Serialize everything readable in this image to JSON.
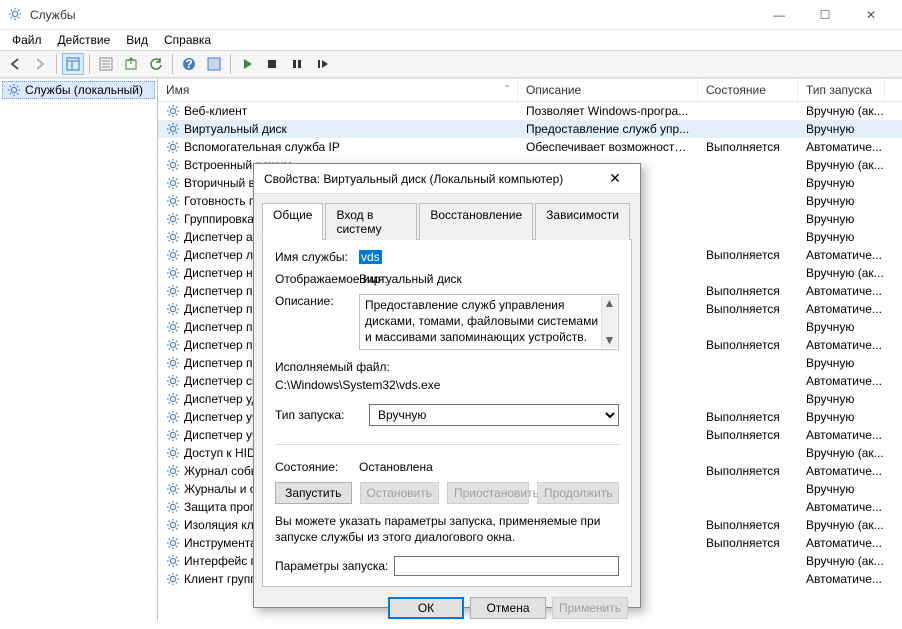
{
  "window": {
    "title": "Службы"
  },
  "menu": {
    "file": "Файл",
    "action": "Действие",
    "view": "Вид",
    "help": "Справка"
  },
  "tree": {
    "root": "Службы (локальный)"
  },
  "columns": {
    "name": "Имя",
    "desc": "Описание",
    "state": "Состояние",
    "type": "Тип запуска"
  },
  "win_controls": {
    "min": "—",
    "max": "☐",
    "close": "✕"
  },
  "services": [
    {
      "name": "Веб-клиент",
      "desc": "Позволяет Windows-програ...",
      "state": "",
      "type": "Вручную (ак..."
    },
    {
      "name": "Виртуальный диск",
      "desc": "Предоставление служб упр...",
      "state": "",
      "type": "Вручную",
      "selected": true
    },
    {
      "name": "Вспомогательная служба IP",
      "desc": "Обеспечивает возможность...",
      "state": "Выполняется",
      "type": "Автоматиче..."
    },
    {
      "name": "Встроенный режим",
      "desc": "",
      "state": "",
      "type": "Вручную (ак..."
    },
    {
      "name": "Вторичный вход в систему",
      "desc": "",
      "state": "",
      "type": "Вручную"
    },
    {
      "name": "Готовность приложений",
      "desc": "",
      "state": "",
      "type": "Вручную"
    },
    {
      "name": "Группировка сетевых участников",
      "desc": "",
      "state": "",
      "type": "Вручную"
    },
    {
      "name": "Диспетчер автоматических подключений",
      "desc": "",
      "state": "",
      "type": "Вручную"
    },
    {
      "name": "Диспетчер локальных сеансов",
      "desc": "",
      "state": "Выполняется",
      "type": "Автоматиче..."
    },
    {
      "name": "Диспетчер настройки устройств",
      "desc": "",
      "state": "",
      "type": "Вручную (ак..."
    },
    {
      "name": "Диспетчер печати",
      "desc": "",
      "state": "Выполняется",
      "type": "Автоматиче..."
    },
    {
      "name": "Диспетчер подключений удаленного доступа",
      "desc": "",
      "state": "Выполняется",
      "type": "Автоматиче..."
    },
    {
      "name": "Диспетчер подключений Windows",
      "desc": "",
      "state": "",
      "type": "Вручную"
    },
    {
      "name": "Диспетчер пользователей",
      "desc": "",
      "state": "Выполняется",
      "type": "Автоматиче..."
    },
    {
      "name": "Диспетчер проверки подлинности Xbox Live",
      "desc": "",
      "state": "",
      "type": "Вручную"
    },
    {
      "name": "Диспетчер скачанных карт",
      "desc": "",
      "state": "",
      "type": "Автоматиче..."
    },
    {
      "name": "Диспетчер удостоверения сетевых участников",
      "desc": "",
      "state": "",
      "type": "Вручную"
    },
    {
      "name": "Диспетчер учетных данных",
      "desc": "",
      "state": "Выполняется",
      "type": "Вручную"
    },
    {
      "name": "Диспетчер учетных записей безопасности",
      "desc": "",
      "state": "Выполняется",
      "type": "Автоматиче..."
    },
    {
      "name": "Доступ к HID-устройствам",
      "desc": "",
      "state": "",
      "type": "Вручную (ак..."
    },
    {
      "name": "Журнал событий Windows",
      "desc": "",
      "state": "Выполняется",
      "type": "Автоматиче..."
    },
    {
      "name": "Журналы и оповещения производительности",
      "desc": "",
      "state": "",
      "type": "Вручную"
    },
    {
      "name": "Защита программного обеспечения",
      "desc": "",
      "state": "",
      "type": "Автоматиче..."
    },
    {
      "name": "Изоляция ключей CNG",
      "desc": "",
      "state": "Выполняется",
      "type": "Вручную (ак..."
    },
    {
      "name": "Инструментарий управления Windows",
      "desc": "",
      "state": "Выполняется",
      "type": "Автоматиче..."
    },
    {
      "name": "Интерфейс гостевой службы Hyper-V",
      "desc": "",
      "state": "",
      "type": "Вручную (ак..."
    },
    {
      "name": "Клиент групповой политики",
      "desc": "",
      "state": "",
      "type": "Автоматиче..."
    }
  ],
  "dialog": {
    "title": "Свойства: Виртуальный диск (Локальный компьютер)",
    "tabs": {
      "general": "Общие",
      "logon": "Вход в систему",
      "recovery": "Восстановление",
      "deps": "Зависимости"
    },
    "labels": {
      "service_name": "Имя службы:",
      "display_name": "Отображаемое имя:",
      "description": "Описание:",
      "executable": "Исполняемый файл:",
      "startup_type": "Тип запуска:",
      "state": "Состояние:",
      "start_params": "Параметры запуска:"
    },
    "values": {
      "service_name": "vds",
      "display_name": "Виртуальный диск",
      "description": "Предоставление служб управления дисками, томами, файловыми системами и массивами запоминающих устройств.",
      "executable": "C:\\Windows\\System32\\vds.exe",
      "startup_type": "Вручную",
      "state": "Остановлена",
      "start_params": ""
    },
    "buttons": {
      "start": "Запустить",
      "stop": "Остановить",
      "pause": "Приостановить",
      "resume": "Продолжить",
      "ok": "ОК",
      "cancel": "Отмена",
      "apply": "Применить"
    },
    "hint": "Вы можете указать параметры запуска, применяемые при запуске службы из этого диалогового окна."
  }
}
